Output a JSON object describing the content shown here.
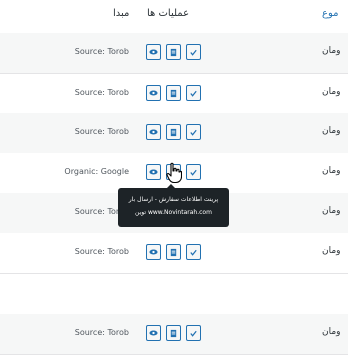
{
  "header": {
    "type_label": "موع",
    "actions_label": "عملیات ها",
    "source_label": "مبدا"
  },
  "rows": [
    {
      "source": "Source: Torob",
      "type": "ومان"
    },
    {
      "source": "Source: Torob",
      "type": "ومان"
    },
    {
      "source": "Source: Torob",
      "type": "ومان"
    },
    {
      "source": "Organic: Google",
      "type": "ومان"
    },
    {
      "source": "Source: Torob",
      "type": "ومان"
    },
    {
      "source": "Source: Torob",
      "type": "ومان"
    },
    {
      "source": "Source: Torob",
      "type": "ومان"
    }
  ],
  "tooltip": {
    "line1": "پرینت اطلاعات سفارش - ارسال بار",
    "line2": "توین www.Novintarah.com"
  },
  "colors": {
    "accent": "#2271b1",
    "tooltip_bg": "#1d2327",
    "row_alt": "#f6f7f7"
  },
  "icons": {
    "view": "eye-icon",
    "doc": "document-icon",
    "check": "checkmark-icon"
  }
}
